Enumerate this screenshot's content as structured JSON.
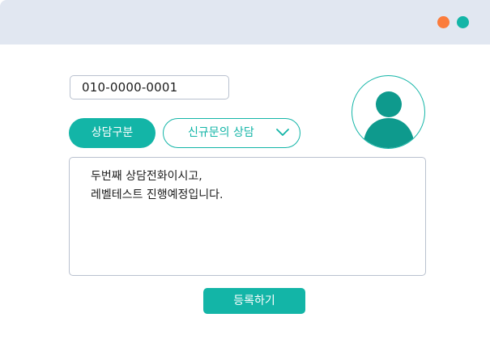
{
  "window": {
    "controls": [
      {
        "name": "orange-dot",
        "color": "#fb7c3c"
      },
      {
        "name": "teal-dot",
        "color": "#13b5a7"
      }
    ]
  },
  "form": {
    "phone_value": "010-0000-0001",
    "category_label": "상담구분",
    "category_select_value": "신규문의 상담",
    "memo_lines": [
      "두번째 상담전화이시고,",
      "레벨테스트 진행예정입니다."
    ],
    "submit_label": "등록하기"
  },
  "icons": {
    "avatar": "user-avatar-icon",
    "dropdown": "chevron-down-icon"
  },
  "colors": {
    "accent": "#13b5a7",
    "titlebar": "#e1e7f1",
    "border": "#b9c1cf",
    "dot_orange": "#fb7c3c"
  }
}
